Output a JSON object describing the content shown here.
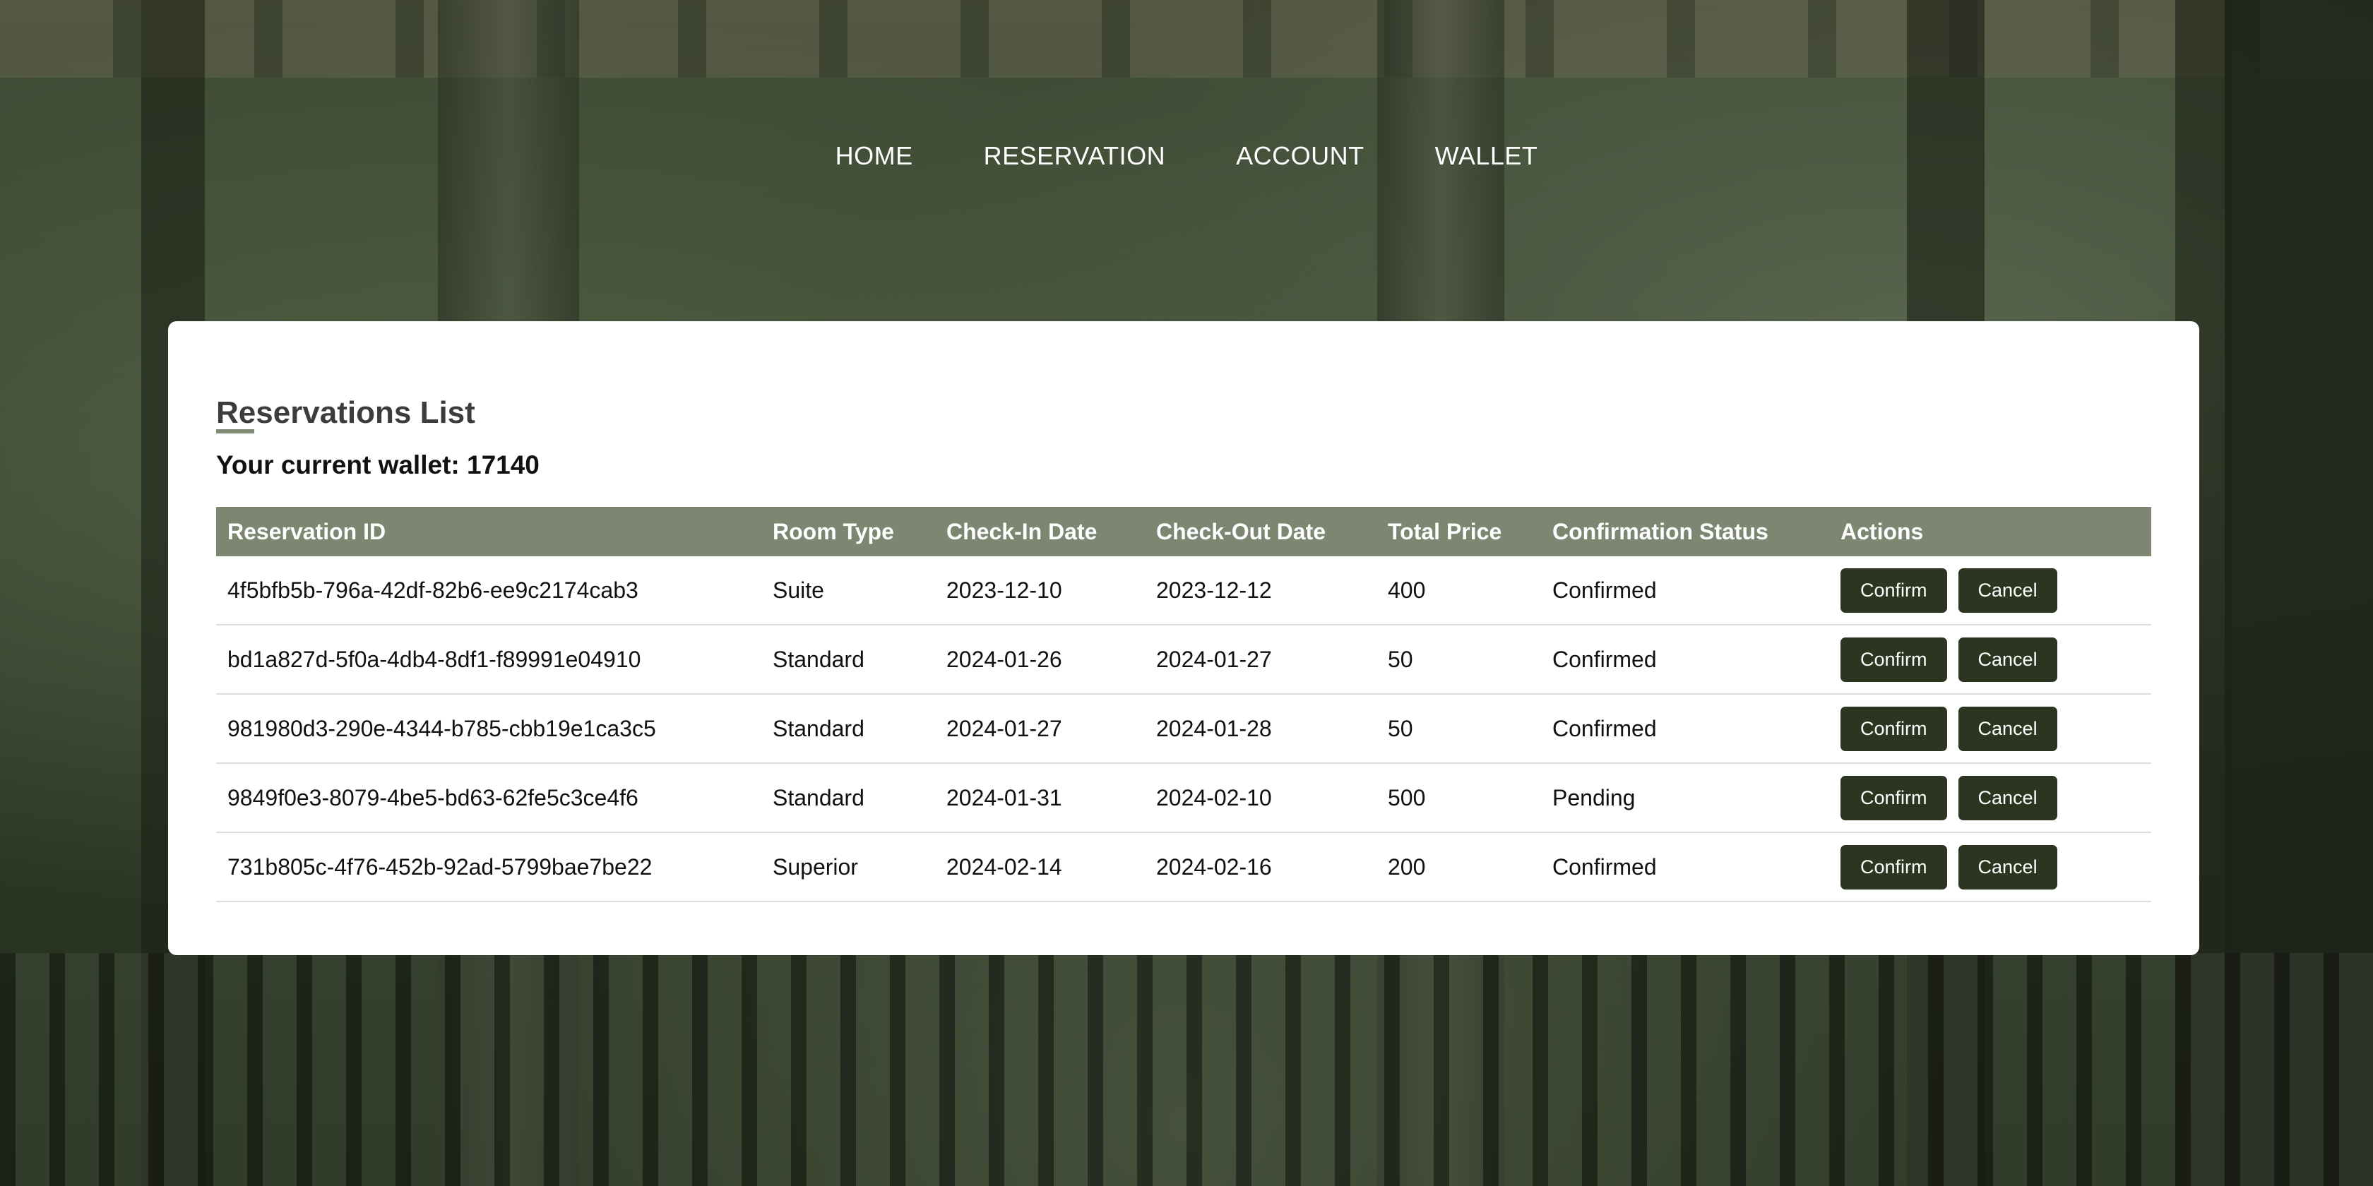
{
  "nav": {
    "items": [
      {
        "label": "HOME"
      },
      {
        "label": "RESERVATION"
      },
      {
        "label": "ACCOUNT"
      },
      {
        "label": "WALLET"
      }
    ]
  },
  "card": {
    "title": "Reservations List",
    "wallet_text": "Your current wallet: 17140"
  },
  "table": {
    "headers": [
      "Reservation ID",
      "Room Type",
      "Check-In Date",
      "Check-Out Date",
      "Total Price",
      "Confirmation Status",
      "Actions"
    ],
    "confirm_label": "Confirm",
    "cancel_label": "Cancel",
    "rows": [
      {
        "id": "4f5bfb5b-796a-42df-82b6-ee9c2174cab3",
        "room": "Suite",
        "checkin": "2023-12-10",
        "checkout": "2023-12-12",
        "price": "400",
        "status": "Confirmed"
      },
      {
        "id": "bd1a827d-5f0a-4db4-8df1-f89991e04910",
        "room": "Standard",
        "checkin": "2024-01-26",
        "checkout": "2024-01-27",
        "price": "50",
        "status": "Confirmed"
      },
      {
        "id": "981980d3-290e-4344-b785-cbb19e1ca3c5",
        "room": "Standard",
        "checkin": "2024-01-27",
        "checkout": "2024-01-28",
        "price": "50",
        "status": "Confirmed"
      },
      {
        "id": "9849f0e3-8079-4be5-bd63-62fe5c3ce4f6",
        "room": "Standard",
        "checkin": "2024-01-31",
        "checkout": "2024-02-10",
        "price": "500",
        "status": "Pending"
      },
      {
        "id": "731b805c-4f76-452b-92ad-5799bae7be22",
        "room": "Superior",
        "checkin": "2024-02-14",
        "checkout": "2024-02-16",
        "price": "200",
        "status": "Confirmed"
      }
    ]
  },
  "colors": {
    "header_bg": "#7c8670",
    "button_bg": "#2c3520",
    "card_bg": "#ffffff"
  }
}
